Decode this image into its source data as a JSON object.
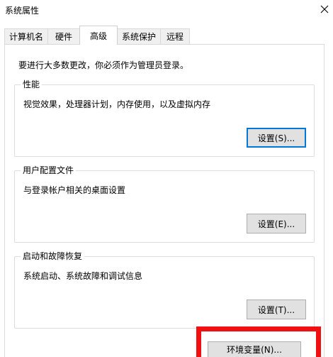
{
  "window": {
    "title": "系统属性"
  },
  "tabs": [
    {
      "label": "计算机名"
    },
    {
      "label": "硬件"
    },
    {
      "label": "高级",
      "active": true
    },
    {
      "label": "系统保护"
    },
    {
      "label": "远程"
    }
  ],
  "admin_note": "要进行大多数更改，你必须作为管理员登录。",
  "performance": {
    "label": "性能",
    "description": "视觉效果，处理器计划，内存使用，以及虚拟内存",
    "button": "设置(S)..."
  },
  "user_profiles": {
    "label": "用户配置文件",
    "description": "与登录帐户相关的桌面设置",
    "button": "设置(E)..."
  },
  "startup_recovery": {
    "label": "启动和故障恢复",
    "description": "系统启动、系统故障和调试信息",
    "button": "设置(T)..."
  },
  "env_button": "环境变量(N)...",
  "colors": {
    "highlight": "#f01010",
    "focus": "#0078d7"
  }
}
